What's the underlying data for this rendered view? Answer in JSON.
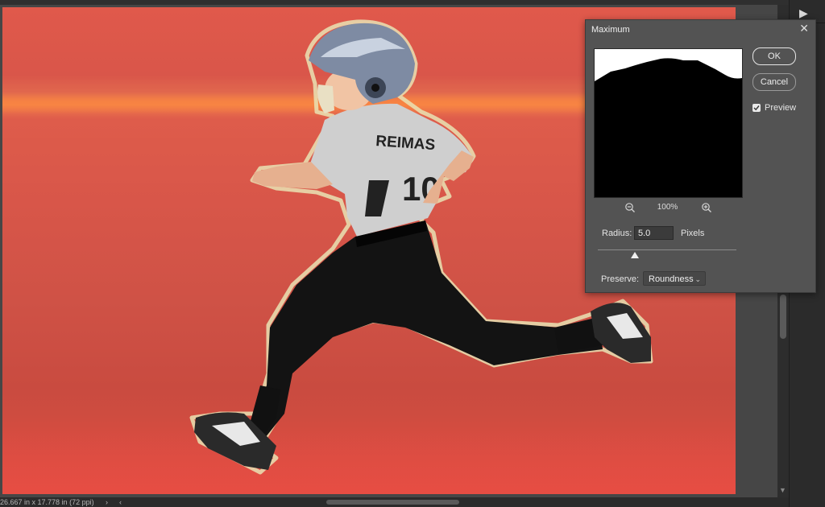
{
  "dialog": {
    "title": "Maximum",
    "ok_label": "OK",
    "cancel_label": "Cancel",
    "preview_label": "Preview",
    "preview_checked": true,
    "zoom_level": "100%",
    "radius_label": "Radius:",
    "radius_value": "5.0",
    "radius_unit": "Pixels",
    "preserve_label": "Preserve:",
    "preserve_value": "Roundness"
  },
  "statusbar": {
    "doc_size": "26.667 in x 17.778 in (72 ppi)",
    "chevron": "›"
  },
  "colors": {
    "canvas_overlay": "#d9564a",
    "dialog_bg": "#535353",
    "app_bg": "#3a3a3a"
  },
  "icons": [
    "close-icon",
    "zoom-out-icon",
    "zoom-in-icon",
    "checkmark-icon",
    "chevron-down-icon",
    "play-icon"
  ]
}
